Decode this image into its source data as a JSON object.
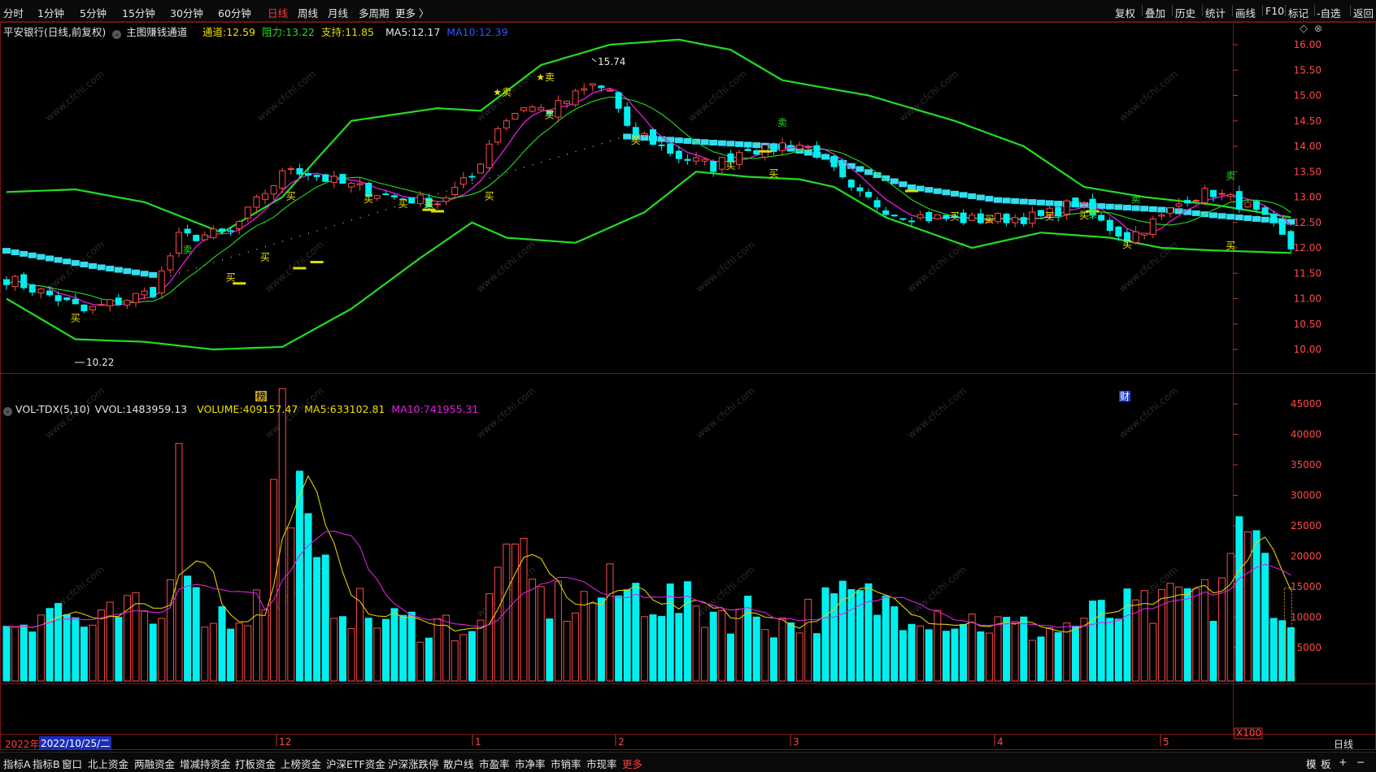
{
  "toolbar": {
    "periods": [
      "分时",
      "1分钟",
      "5分钟",
      "15分钟",
      "30分钟",
      "60分钟",
      "日线",
      "周线",
      "月线",
      "多周期",
      "更多 〉"
    ],
    "active_period": "日线",
    "right_buttons": [
      "复权",
      "叠加",
      "历史",
      "统计",
      "画线",
      "F10",
      "标记",
      "-自选",
      "返回"
    ]
  },
  "price_panel": {
    "title": "平安银行(日线,前复权)",
    "indicator": "主图赚钱通道",
    "channel_label": "通道:",
    "channel_value": "12.59",
    "resistance_label": "阻力:",
    "resistance_value": "13.22",
    "support_label": "支持:",
    "support_value": "11.85",
    "ma5_label": "MA5:",
    "ma5_value": "12.17",
    "ma10_label": "MA10:",
    "ma10_value": "12.39",
    "high_label": "15.74",
    "low_label": "10.22",
    "event_left": "榜",
    "event_right": "财",
    "buy_label": "买",
    "sell_label": "卖",
    "star_label": "★卖",
    "y_ticks": [
      "16.00",
      "15.50",
      "15.00",
      "14.50",
      "14.00",
      "13.50",
      "13.00",
      "12.50",
      "12.00",
      "11.50",
      "11.00",
      "10.50",
      "10.00"
    ]
  },
  "volume_panel": {
    "indicator": "VOL-TDX(5,10)",
    "vvol_label": "VVOL:",
    "vvol_value": "1483959.13",
    "volume_label": "VOLUME:",
    "volume_value": "409157.47",
    "ma5_label": "MA5:",
    "ma5_value": "633102.81",
    "ma10_label": "MA10:",
    "ma10_value": "741955.31",
    "y_ticks": [
      "45000",
      "40000",
      "35000",
      "30000",
      "25000",
      "20000",
      "15000",
      "10000",
      "5000"
    ],
    "unit": "X100"
  },
  "time_axis": {
    "year": "2022年",
    "cursor_date": "2022/10/25/二",
    "months": [
      "12",
      "1",
      "2",
      "3",
      "4",
      "5"
    ],
    "period": "日线"
  },
  "bottom_tabs": [
    "指标A",
    "指标B",
    "窗口",
    "北上资金",
    "两融资金",
    "增减持资金",
    "打板资金",
    "上榜资金",
    "沪深ETF资金",
    "沪深涨跌停",
    "散户线",
    "市盈率",
    "市净率",
    "市销率",
    "市现率",
    "更多"
  ],
  "bottom_right": [
    "模",
    "板",
    "+",
    "−"
  ],
  "watermark": "www.cfchi.com",
  "colors": {
    "up": "#ff4a4a",
    "down": "#00f0f0",
    "boll": "#22dd22",
    "ma5": "#e0d000",
    "ma10": "#e020e0",
    "channel": "#33ddee",
    "resistance": "#22dd22",
    "support": "#dddd00"
  }
}
